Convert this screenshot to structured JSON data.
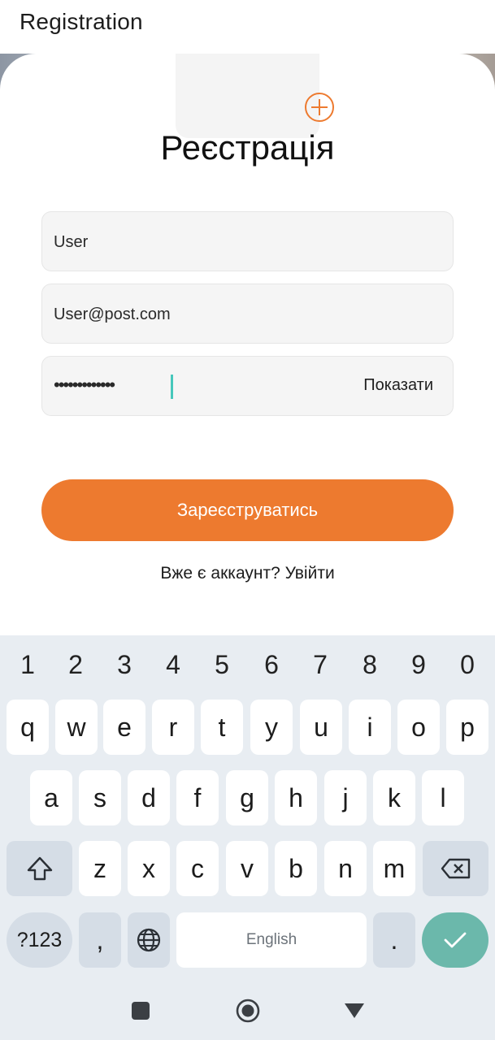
{
  "appbar": {
    "title": "Registration"
  },
  "form": {
    "title": "Реєстрація",
    "name_value": "User",
    "email_value": "User@post.com",
    "password_masked": "•••••••••••••",
    "show_password_label": "Показати",
    "submit_label": "Зареєструватись",
    "login_prompt": "Вже є аккаунт? Увійти"
  },
  "keyboard": {
    "numbers": [
      "1",
      "2",
      "3",
      "4",
      "5",
      "6",
      "7",
      "8",
      "9",
      "0"
    ],
    "row1": [
      "q",
      "w",
      "e",
      "r",
      "t",
      "y",
      "u",
      "i",
      "o",
      "p"
    ],
    "row2": [
      "a",
      "s",
      "d",
      "f",
      "g",
      "h",
      "j",
      "k",
      "l"
    ],
    "row3": [
      "z",
      "x",
      "c",
      "v",
      "b",
      "n",
      "m"
    ],
    "symbols_label": "?123",
    "comma_label": ",",
    "space_label": "English",
    "period_label": "."
  },
  "colors": {
    "accent": "#ed7a2f",
    "caret": "#46c7bb",
    "enter_key": "#6bb8ab"
  }
}
